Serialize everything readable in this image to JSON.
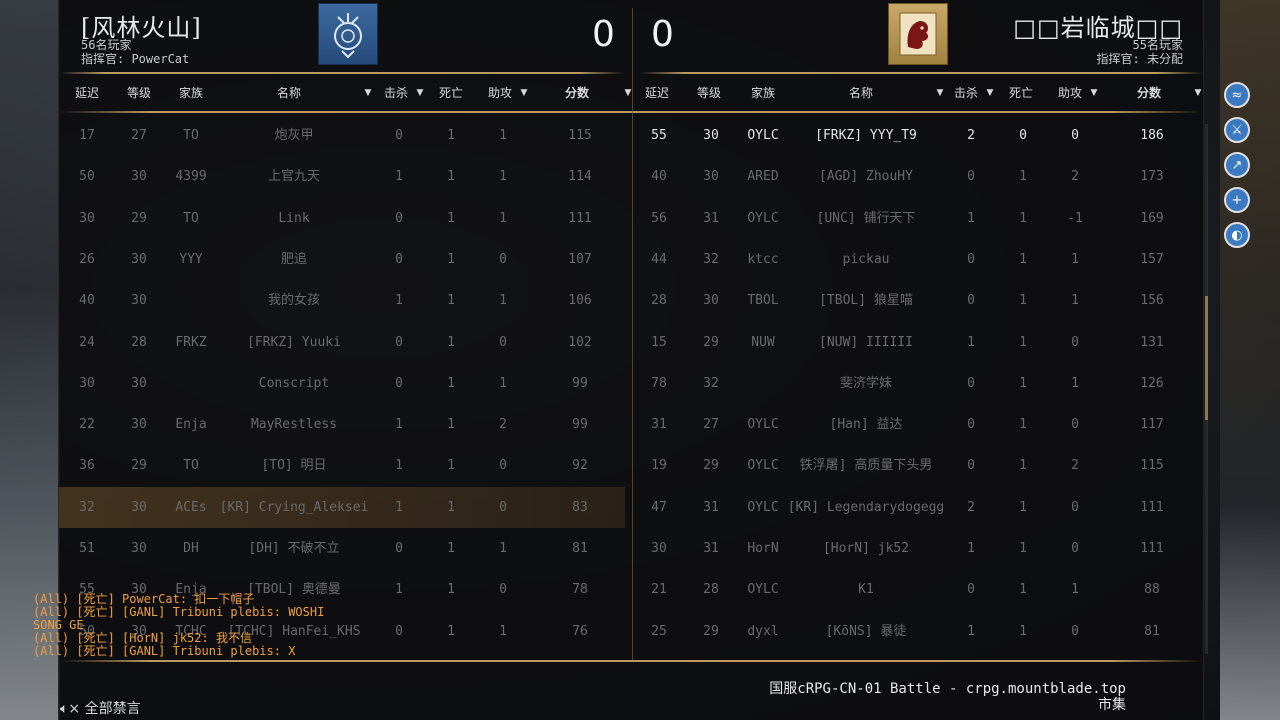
{
  "left_team": {
    "name": "[风林火山]",
    "players_count": "56名玩家",
    "commander": "指挥官: PowerCat",
    "score": "0",
    "banner_color": "#2f5d96"
  },
  "right_team": {
    "name": "□□岩临城□□",
    "players_count": "55名玩家",
    "commander": "指挥官: 未分配",
    "score": "0",
    "banner_color": "#b8964f"
  },
  "headers": {
    "ping": "延迟",
    "level": "等级",
    "clan": "家族",
    "name": "名称",
    "kills": "击杀",
    "deaths": "死亡",
    "assists": "助攻",
    "score": "分数"
  },
  "left_rows": [
    {
      "ping": "17",
      "level": "27",
      "clan": "TO",
      "name": "炮灰甲",
      "kills": "0",
      "deaths": "1",
      "assists": "1",
      "score": "115"
    },
    {
      "ping": "50",
      "level": "30",
      "clan": "4399",
      "name": "上官九天",
      "kills": "1",
      "deaths": "1",
      "assists": "1",
      "score": "114"
    },
    {
      "ping": "30",
      "level": "29",
      "clan": "TO",
      "name": "Link",
      "kills": "0",
      "deaths": "1",
      "assists": "1",
      "score": "111"
    },
    {
      "ping": "26",
      "level": "30",
      "clan": "YYY",
      "name": "肥追",
      "kills": "0",
      "deaths": "1",
      "assists": "0",
      "score": "107"
    },
    {
      "ping": "40",
      "level": "30",
      "clan": "",
      "name": "我的女孩",
      "kills": "1",
      "deaths": "1",
      "assists": "1",
      "score": "106"
    },
    {
      "ping": "24",
      "level": "28",
      "clan": "FRKZ",
      "name": "[FRKZ] Yuuki",
      "kills": "0",
      "deaths": "1",
      "assists": "0",
      "score": "102"
    },
    {
      "ping": "30",
      "level": "30",
      "clan": "",
      "name": "Conscript",
      "kills": "0",
      "deaths": "1",
      "assists": "1",
      "score": "99"
    },
    {
      "ping": "22",
      "level": "30",
      "clan": "Enja",
      "name": "MayRestless",
      "kills": "1",
      "deaths": "1",
      "assists": "2",
      "score": "99"
    },
    {
      "ping": "36",
      "level": "29",
      "clan": "TO",
      "name": "[TO] 明日",
      "kills": "1",
      "deaths": "1",
      "assists": "0",
      "score": "92"
    },
    {
      "ping": "32",
      "level": "30",
      "clan": "ACEs",
      "name": "[KR] Crying_Aleksei",
      "kills": "1",
      "deaths": "1",
      "assists": "0",
      "score": "83",
      "highlight": true
    },
    {
      "ping": "51",
      "level": "30",
      "clan": "DH",
      "name": "[DH] 不破不立",
      "kills": "0",
      "deaths": "1",
      "assists": "1",
      "score": "81"
    },
    {
      "ping": "55",
      "level": "30",
      "clan": "Enja",
      "name": "[TBOL] 奥德曼",
      "kills": "1",
      "deaths": "1",
      "assists": "0",
      "score": "78"
    },
    {
      "ping": "50",
      "level": "30",
      "clan": "TCHC",
      "name": "[TCHC] HanFei_KHS",
      "kills": "0",
      "deaths": "1",
      "assists": "1",
      "score": "76"
    }
  ],
  "right_rows": [
    {
      "ping": "55",
      "level": "30",
      "clan": "OYLC",
      "name": "[FRKZ] YYY_T9",
      "kills": "2",
      "deaths": "0",
      "assists": "0",
      "score": "186",
      "bright": true
    },
    {
      "ping": "40",
      "level": "30",
      "clan": "ARED",
      "name": "[AGD] ZhouHY",
      "kills": "0",
      "deaths": "1",
      "assists": "2",
      "score": "173"
    },
    {
      "ping": "56",
      "level": "31",
      "clan": "OYLC",
      "name": "[UNC] 铺行天下",
      "kills": "1",
      "deaths": "1",
      "assists": "-1",
      "score": "169"
    },
    {
      "ping": "44",
      "level": "32",
      "clan": "ktcc",
      "name": "pickau",
      "kills": "0",
      "deaths": "1",
      "assists": "1",
      "score": "157"
    },
    {
      "ping": "28",
      "level": "30",
      "clan": "TBOL",
      "name": "[TBOL] 狼星喵",
      "kills": "0",
      "deaths": "1",
      "assists": "1",
      "score": "156"
    },
    {
      "ping": "15",
      "level": "29",
      "clan": "NUW",
      "name": "[NUW] IIIIII",
      "kills": "1",
      "deaths": "1",
      "assists": "0",
      "score": "131"
    },
    {
      "ping": "78",
      "level": "32",
      "clan": "",
      "name": "斐济学妹",
      "kills": "0",
      "deaths": "1",
      "assists": "1",
      "score": "126"
    },
    {
      "ping": "31",
      "level": "27",
      "clan": "OYLC",
      "name": "[Han] 益达",
      "kills": "0",
      "deaths": "1",
      "assists": "0",
      "score": "117"
    },
    {
      "ping": "19",
      "level": "29",
      "clan": "OYLC",
      "name": "铁浮屠] 高质量下头男",
      "kills": "0",
      "deaths": "1",
      "assists": "2",
      "score": "115"
    },
    {
      "ping": "47",
      "level": "31",
      "clan": "OYLC",
      "name": "[KR] Legendarydogegg",
      "kills": "2",
      "deaths": "1",
      "assists": "0",
      "score": "111"
    },
    {
      "ping": "30",
      "level": "31",
      "clan": "HorN",
      "name": "[HorN] jk52",
      "kills": "1",
      "deaths": "1",
      "assists": "0",
      "score": "111"
    },
    {
      "ping": "21",
      "level": "28",
      "clan": "OYLC",
      "name": "K1",
      "kills": "0",
      "deaths": "1",
      "assists": "1",
      "score": "88"
    },
    {
      "ping": "25",
      "level": "29",
      "clan": "dyxl",
      "name": "[KōNS] 暴徒",
      "kills": "1",
      "deaths": "1",
      "assists": "0",
      "score": "81"
    }
  ],
  "chat": [
    "(All) [死亡] PowerCat: 扣一下帽子",
    "(All) [死亡] [GANL] Tribuni plebis: WOSHI",
    "SONG GE",
    "(All) [死亡] [HorN] jk52: 我不信",
    "(All) [死亡] [GANL] Tribuni plebis: X"
  ],
  "server": {
    "name": "国服cRPG-CN-01 Battle - crpg.mountblade.top",
    "mode": "市集"
  },
  "mute_label": "全部禁言",
  "side_icons": [
    "fish-icon",
    "sword-icon",
    "spear-icon",
    "plus-icon",
    "shield-icon"
  ]
}
